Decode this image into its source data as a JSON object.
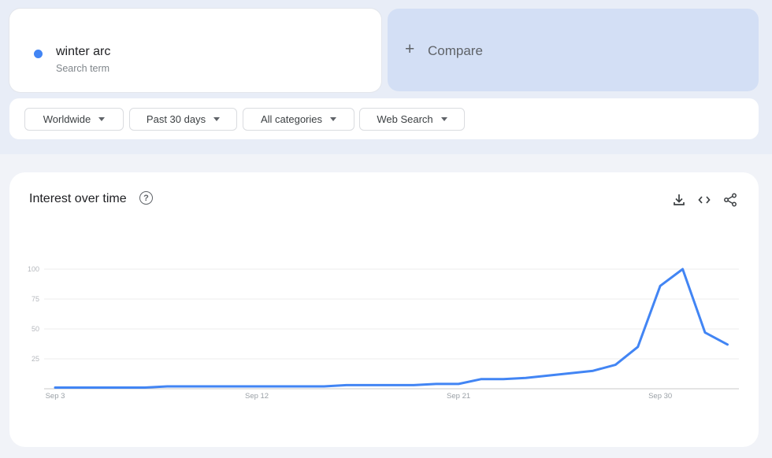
{
  "search_term": {
    "name": "winter arc",
    "type_label": "Search term",
    "color": "#4285f4"
  },
  "compare": {
    "icon": "plus-icon",
    "label": "Compare"
  },
  "filters": [
    {
      "label": "Worldwide"
    },
    {
      "label": "Past 30 days"
    },
    {
      "label": "All categories"
    },
    {
      "label": "Web Search"
    }
  ],
  "chart_card": {
    "title": "Interest over time",
    "help_icon": "help-circle-icon",
    "actions": [
      {
        "name": "download-icon"
      },
      {
        "name": "embed-code-icon"
      },
      {
        "name": "share-icon"
      }
    ]
  },
  "chart_data": {
    "type": "line",
    "title": "Interest over time",
    "xlabel": "",
    "ylabel": "",
    "ylim": [
      0,
      100
    ],
    "yticks": [
      25,
      50,
      75,
      100
    ],
    "grid": true,
    "legend": "none",
    "x_tick_labels": [
      {
        "label": "Sep 3",
        "index": 0
      },
      {
        "label": "Sep 12",
        "index": 9
      },
      {
        "label": "Sep 21",
        "index": 18
      },
      {
        "label": "Sep 30",
        "index": 27
      }
    ],
    "x": [
      "Sep 3",
      "Sep 4",
      "Sep 5",
      "Sep 6",
      "Sep 7",
      "Sep 8",
      "Sep 9",
      "Sep 10",
      "Sep 11",
      "Sep 12",
      "Sep 13",
      "Sep 14",
      "Sep 15",
      "Sep 16",
      "Sep 17",
      "Sep 18",
      "Sep 19",
      "Sep 20",
      "Sep 21",
      "Sep 22",
      "Sep 23",
      "Sep 24",
      "Sep 25",
      "Sep 26",
      "Sep 27",
      "Sep 28",
      "Sep 29",
      "Sep 30",
      "Oct 1",
      "Oct 2",
      "Oct 3"
    ],
    "series": [
      {
        "name": "winter arc",
        "color": "#4285f4",
        "values": [
          1,
          1,
          1,
          1,
          1,
          2,
          2,
          2,
          2,
          2,
          2,
          2,
          2,
          3,
          3,
          3,
          3,
          4,
          4,
          8,
          8,
          9,
          11,
          13,
          15,
          20,
          35,
          86,
          100,
          47,
          37
        ]
      }
    ]
  }
}
